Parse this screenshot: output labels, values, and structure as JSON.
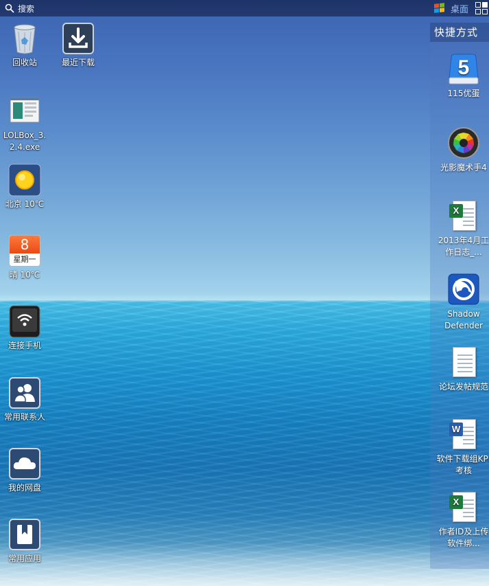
{
  "topbar": {
    "search_label": "搜索",
    "desktop_label": "桌面"
  },
  "desktop_icons": [
    {
      "label": "回收站",
      "icon": "recycle-bin-icon"
    },
    {
      "label": "最近下载",
      "icon": "download-icon"
    },
    {
      "label": "LOLBox_3.2.4.exe",
      "icon": "lolbox-app-icon"
    },
    {
      "label": "北京 10℃",
      "icon": "sun-weather-icon"
    },
    {
      "label": "晴 10℃",
      "icon": "calendar-icon",
      "date_number": "8",
      "weekday": "星期一"
    },
    {
      "label": "连接手机",
      "icon": "phone-wifi-icon"
    },
    {
      "label": "常用联系人",
      "icon": "contacts-icon"
    },
    {
      "label": "我的网盘",
      "icon": "cloud-drive-icon"
    },
    {
      "label": "常用应用",
      "icon": "bookmark-app-icon"
    }
  ],
  "shortcuts": {
    "title": "快捷方式",
    "items": [
      {
        "label": "115优蛋",
        "icon": "115-drive-icon",
        "logo_text": "5"
      },
      {
        "label": "光影魔术手4",
        "icon": "camera-lens-icon"
      },
      {
        "label": "2013年4月工作日志_...",
        "icon": "excel-file-icon",
        "badge_text": "X"
      },
      {
        "label": "Shadow Defender",
        "icon": "shadow-defender-icon"
      },
      {
        "label": "论坛发帖规范",
        "icon": "text-file-icon"
      },
      {
        "label": "软件下载组KPI考核",
        "icon": "word-file-icon",
        "badge_text": "W"
      },
      {
        "label": "作者ID及上传软件绑...",
        "icon": "excel-file-icon",
        "badge_text": "X"
      }
    ]
  },
  "colors": {
    "topbar": "#1e3468",
    "desktop_label": "#8fc3ff",
    "excel_green": "#1e7a3c",
    "word_blue": "#2a5db0"
  }
}
